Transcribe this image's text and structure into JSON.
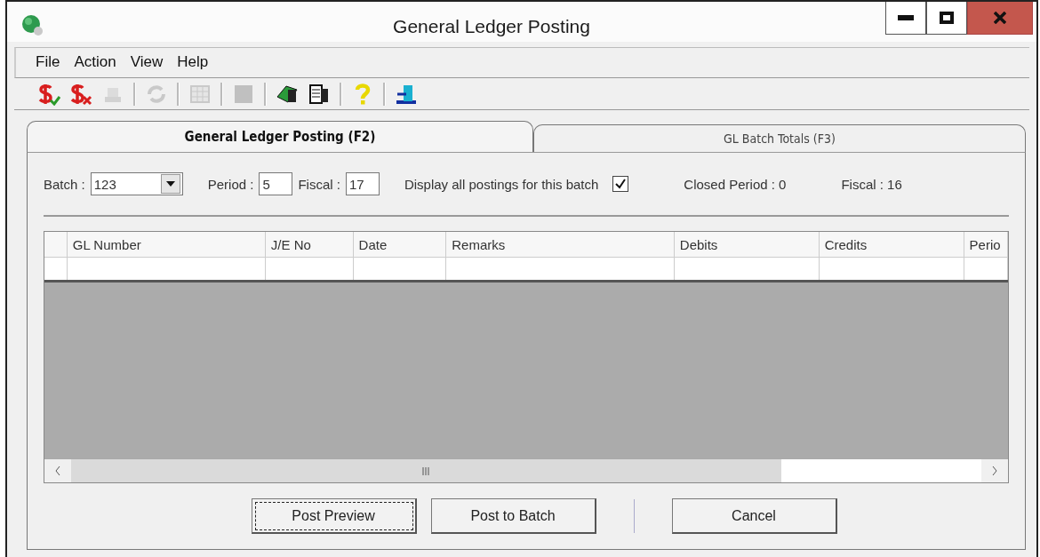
{
  "window": {
    "title": "General Ledger Posting"
  },
  "menu": [
    {
      "label": "File"
    },
    {
      "label": "Action"
    },
    {
      "label": "View"
    },
    {
      "label": "Help"
    }
  ],
  "toolbar": [
    {
      "kind": "post",
      "disabled": false
    },
    {
      "kind": "unpost",
      "disabled": false
    },
    {
      "kind": "stamp",
      "disabled": true
    },
    {
      "kind": "separator"
    },
    {
      "kind": "refresh",
      "disabled": true
    },
    {
      "kind": "separator"
    },
    {
      "kind": "grid",
      "disabled": true
    },
    {
      "kind": "separator"
    },
    {
      "kind": "square",
      "disabled": true
    },
    {
      "kind": "separator"
    },
    {
      "kind": "books",
      "disabled": false
    },
    {
      "kind": "ledger",
      "disabled": false
    },
    {
      "kind": "separator"
    },
    {
      "kind": "help",
      "disabled": false
    },
    {
      "kind": "separator"
    },
    {
      "kind": "exit",
      "disabled": false
    }
  ],
  "tabs": [
    {
      "label": "General Ledger Posting (F2)",
      "selected": true
    },
    {
      "label": "GL Batch Totals (F3)",
      "selected": false
    }
  ],
  "filters": {
    "batch_label": "Batch :",
    "batch_value": "123",
    "period_label": "Period :",
    "period_value": "5",
    "fiscal_label": "Fiscal :",
    "fiscal_value": "17",
    "display_all_label": "Display all postings for this batch",
    "display_all_checked": true,
    "closed_period": "Closed Period : 0",
    "fiscal_info": "Fiscal : 16"
  },
  "table": {
    "columns": [
      "GL Number",
      "J/E No",
      "Date",
      "Remarks",
      "Debits",
      "Credits",
      "Perio"
    ]
  },
  "buttons": [
    {
      "label": "Post Preview",
      "focused": true
    },
    {
      "label": "Post to Batch",
      "focused": false
    },
    {
      "label": "Cancel",
      "focused": false
    }
  ]
}
